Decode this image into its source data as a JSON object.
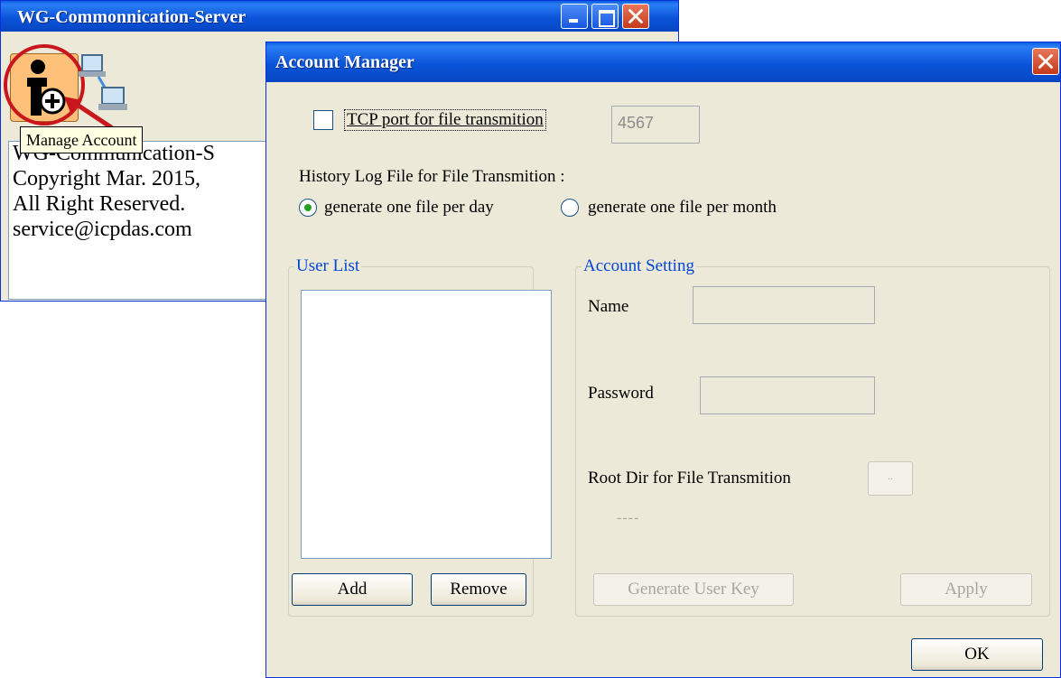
{
  "main_window": {
    "title": "WG-Commonnication-Server",
    "tooltip": "Manage Account",
    "info_lines": [
      "WG-Communication-S",
      "Copyright Mar. 2015,",
      "All Right Reserved.",
      "service@icpdas.com"
    ]
  },
  "dialog": {
    "title": "Account Manager",
    "tcp_checkbox_label": "TCP port for file transmition",
    "tcp_port_value": "4567",
    "history_label": "History Log File for File Transmition :",
    "radio_per_day": "generate one file per day",
    "radio_per_month": "generate one file per month",
    "selected_radio": "per_day",
    "user_list": {
      "legend": "User List",
      "add_label": "Add",
      "remove_label": "Remove"
    },
    "account_setting": {
      "legend": "Account Setting",
      "name_label": "Name",
      "password_label": "Password",
      "root_dir_label": "Root Dir for File Transmition",
      "browse_label": "..",
      "root_dir_value": "----",
      "generate_key_label": "Generate User Key",
      "apply_label": "Apply"
    },
    "ok_label": "OK"
  },
  "colors": {
    "titlebar": "#0b54d9",
    "highlight": "#c8161c",
    "group_legend": "#0046d5",
    "dialog_bg": "#ece9d8"
  },
  "icons": [
    "manage-account-icon",
    "network-computers-icon",
    "minimize-icon",
    "maximize-icon",
    "close-icon",
    "arrow-pointer-icon"
  ]
}
